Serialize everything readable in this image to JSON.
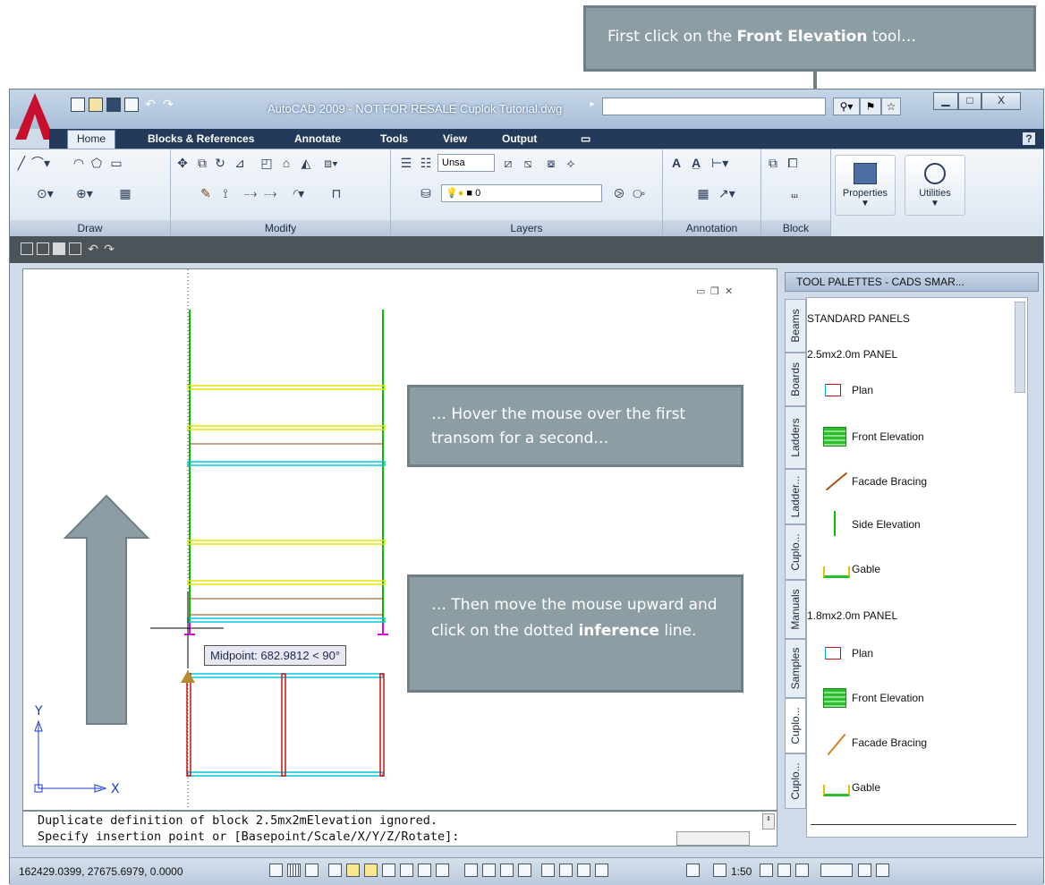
{
  "callouts": {
    "top": {
      "prefix": "First click on the ",
      "bold": "Front Elevation",
      "suffix": " tool…"
    },
    "middle": {
      "text": "… Hover the mouse over the first transom for a second…"
    },
    "bottom": {
      "prefix": "… Then move the mouse upward and click on the dotted ",
      "bold": "inference",
      "suffix": " line."
    }
  },
  "titlebar": {
    "title": "AutoCAD 2009 - NOT FOR RESALE Cuplok Tutorial.dwg"
  },
  "ribbon_tabs": [
    "Home",
    "Blocks & References",
    "Annotate",
    "Tools",
    "View",
    "Output"
  ],
  "ribbon_panels": {
    "draw": "Draw",
    "modify": "Modify",
    "layers": "Layers",
    "annotation": "Annotation",
    "block": "Block",
    "properties": "Properties",
    "utilities": "Utilities"
  },
  "layers": {
    "text_style": "Unsa",
    "current_layer": "0"
  },
  "canvas": {
    "tooltip": "Midpoint: 682.9812 < 90°",
    "axis_y": "Y",
    "axis_x": "X"
  },
  "command_line": {
    "line1": "Duplicate definition of block 2.5mx2mElevation  ignored.",
    "line2": "Specify insertion point or [Basepoint/Scale/X/Y/Z/Rotate]:"
  },
  "status_bar": {
    "coords": "162429.0399, 27675.6979, 0.0000",
    "scale": "1:50"
  },
  "tool_palette": {
    "title": "TOOL PALETTES - CADS SMAR...",
    "tabs": [
      "Beams",
      "Boards",
      "Ladders",
      "Ladder...",
      "Cuplo...",
      "Manuals",
      "Samples",
      "Cuplo...",
      "Cuplo..."
    ],
    "section_header": "STANDARD PANELS",
    "group1": {
      "title": "2.5mx2.0m PANEL",
      "items": [
        "Plan",
        "Front Elevation",
        "Facade Bracing",
        "Side Elevation",
        "Gable"
      ]
    },
    "group2": {
      "title": "1.8mx2.0m PANEL",
      "items": [
        "Plan",
        "Front Elevation",
        "Facade Bracing",
        "Gable"
      ]
    }
  },
  "colors": {
    "callout_bg": "#8c9ea4",
    "autocad_red": "#c8102e",
    "ribbon_tab_bar": "#233a5a",
    "scaffold_green": "#00c000",
    "scaffold_yellow": "#e6e600",
    "scaffold_cyan": "#00c8e0",
    "scaffold_red": "#d01010",
    "scaffold_brown": "#8b4a10"
  }
}
